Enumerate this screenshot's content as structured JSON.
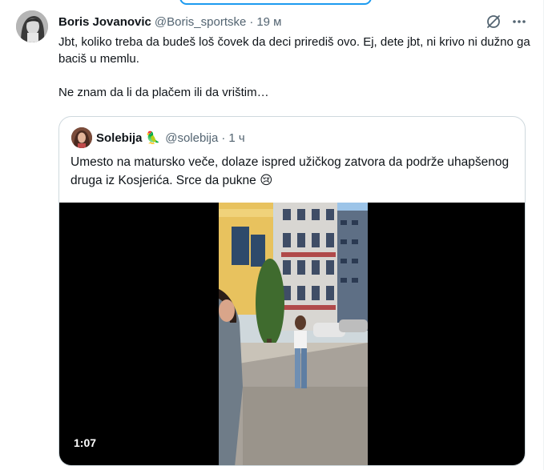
{
  "tweet": {
    "author_name": "Boris Jovanovic",
    "author_handle": "@Boris_sportske",
    "separator": "·",
    "time": "19 м",
    "text": "Jbt, koliko treba da budeš loš čovek da deci prirediš ovo. Ej, dete jbt, ni krivo ni dužno ga baciš u memlu.\n\nNe znam da li da plačem ili da vrištim…",
    "icons": {
      "grok": "grok-icon",
      "more": "more-icon"
    }
  },
  "quote": {
    "author_name": "Solebija",
    "author_badge_emoji": "🦜",
    "author_handle": "@solebija",
    "separator": "·",
    "time": "1 ч",
    "text": "Umesto na matursko veče, dolaze ispred užičkog zatvora da podrže uhapšenog druga iz Kosjerića. Srce da pukne 😢",
    "video": {
      "duration": "1:07"
    }
  },
  "colors": {
    "text_primary": "#0f1419",
    "text_secondary": "#536471",
    "border": "#cfd9de",
    "accent": "#1d9bf0"
  }
}
